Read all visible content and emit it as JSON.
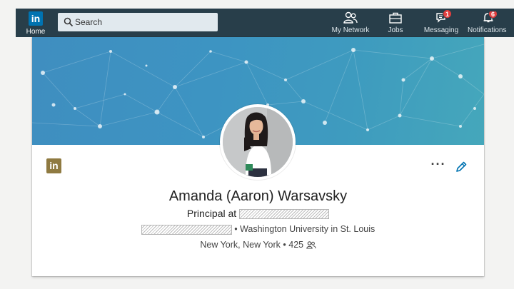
{
  "nav": {
    "home_label": "Home",
    "logo_text": "in",
    "search_placeholder": "Search",
    "items": [
      {
        "label": "My Network",
        "icon": "people-icon"
      },
      {
        "label": "Jobs",
        "icon": "briefcase-icon"
      },
      {
        "label": "Messaging",
        "icon": "chat-icon",
        "badge": "1"
      },
      {
        "label": "Notifications",
        "icon": "bell-icon",
        "badge": "6"
      }
    ]
  },
  "profile": {
    "brand_badge": "in",
    "more_label": "···",
    "name": "Amanda (Aaron) Warsavsky",
    "headline_prefix": "Principal at",
    "school_separator": "• Washington University in St. Louis",
    "location": "New York, New York",
    "separator": "•",
    "connections": "425"
  },
  "colors": {
    "nav_bg": "#283e4a",
    "brand_blue": "#0073b1",
    "badge_red": "#e23e3e",
    "premium_gold": "#8f7a41"
  }
}
